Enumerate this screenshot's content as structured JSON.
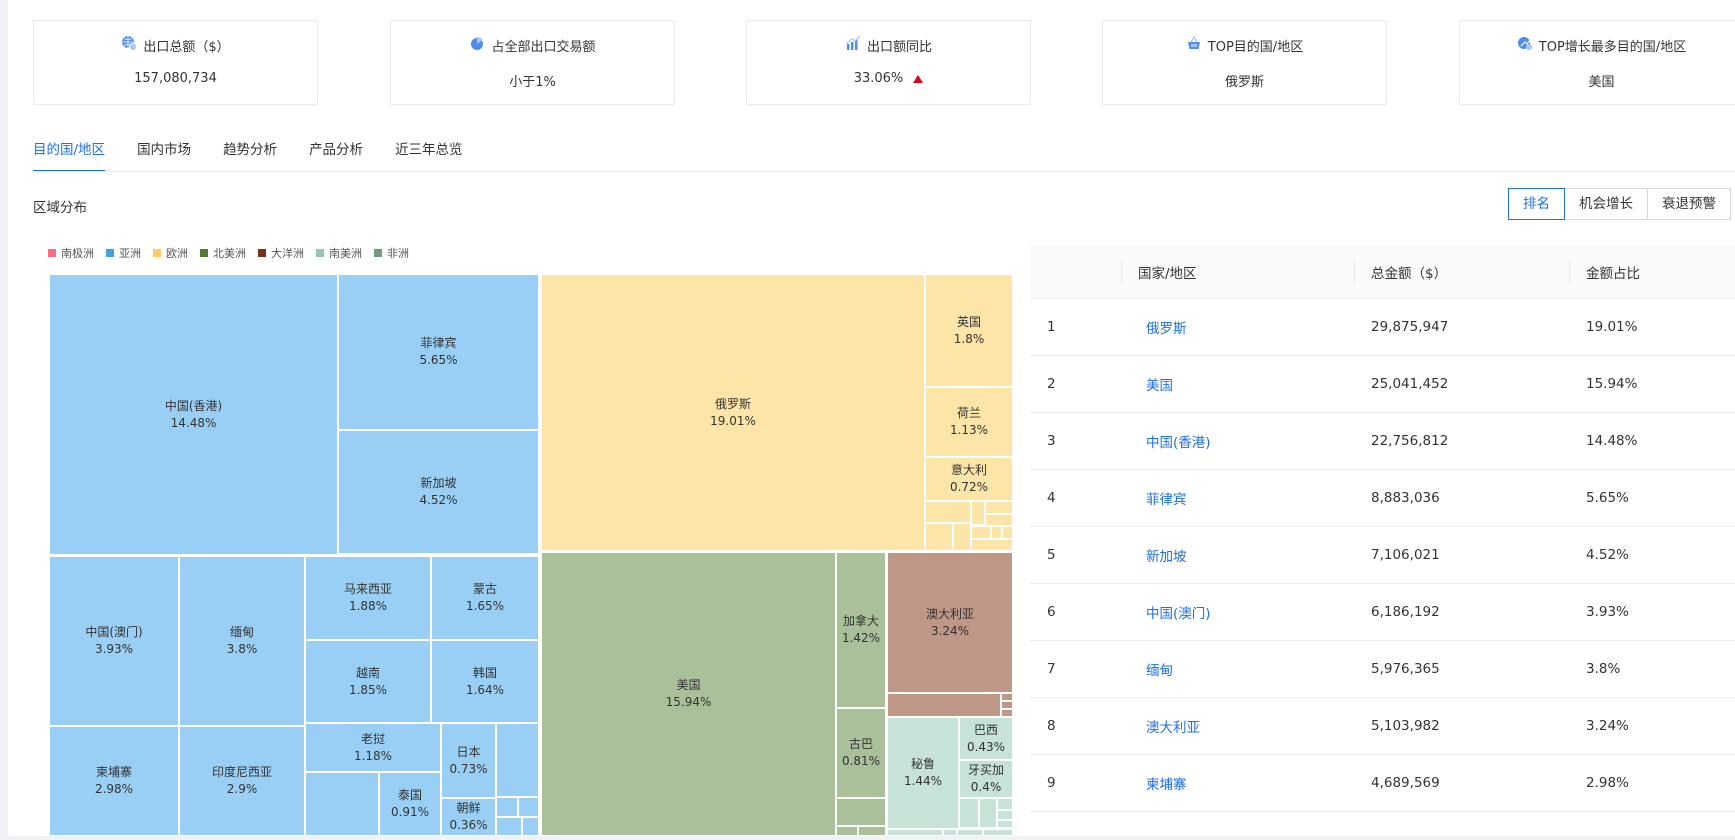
{
  "cards": [
    {
      "title": "出口总额（$）",
      "value": "157,080,734",
      "icon": "globe-dollar-icon"
    },
    {
      "title": "占全部出口交易额",
      "value": "小于1%",
      "icon": "pie-icon"
    },
    {
      "title": "出口额同比",
      "value": "33.06%",
      "icon": "bar-chart-icon",
      "trend": "up"
    },
    {
      "title": "TOP目的国/地区",
      "value": "俄罗斯",
      "icon": "basket-icon"
    },
    {
      "title": "TOP增长最多目的国/地区",
      "value": "美国",
      "icon": "globe-growth-icon"
    }
  ],
  "tabs": [
    "目的国/地区",
    "国内市场",
    "趋势分析",
    "产品分析",
    "近三年总览"
  ],
  "active_tab": "目的国/地区",
  "section_title": "区域分布",
  "view_buttons": [
    "排名",
    "机会增长",
    "衰退预警"
  ],
  "active_view": "排名",
  "colors": {
    "accent": "#1f6fe8",
    "up": "#d9001b"
  },
  "chart_data": {
    "type": "treemap",
    "legend": [
      {
        "name": "南极洲",
        "color": "#ff6b81"
      },
      {
        "name": "亚洲",
        "color": "#3ea0e8"
      },
      {
        "name": "欧洲",
        "color": "#ffc95c"
      },
      {
        "name": "北美洲",
        "color": "#4e7f2f"
      },
      {
        "name": "大洋洲",
        "color": "#7a3118"
      },
      {
        "name": "南美洲",
        "color": "#92c8b0"
      },
      {
        "name": "非洲",
        "color": "#6f9c7c"
      }
    ],
    "legend_position": "top-left",
    "nodes": [
      {
        "name": "中国(香港)",
        "value": "14.48%",
        "region": "亚洲"
      },
      {
        "name": "菲律宾",
        "value": "5.65%",
        "region": "亚洲"
      },
      {
        "name": "新加坡",
        "value": "4.52%",
        "region": "亚洲"
      },
      {
        "name": "中国(澳门)",
        "value": "3.93%",
        "region": "亚洲"
      },
      {
        "name": "缅甸",
        "value": "3.8%",
        "region": "亚洲"
      },
      {
        "name": "柬埔寨",
        "value": "2.98%",
        "region": "亚洲"
      },
      {
        "name": "印度尼西亚",
        "value": "2.9%",
        "region": "亚洲"
      },
      {
        "name": "马来西亚",
        "value": "1.88%",
        "region": "亚洲"
      },
      {
        "name": "蒙古",
        "value": "1.65%",
        "region": "亚洲"
      },
      {
        "name": "越南",
        "value": "1.85%",
        "region": "亚洲"
      },
      {
        "name": "韩国",
        "value": "1.64%",
        "region": "亚洲"
      },
      {
        "name": "老挝",
        "value": "1.18%",
        "region": "亚洲"
      },
      {
        "name": "日本",
        "value": "0.73%",
        "region": "亚洲"
      },
      {
        "name": "泰国",
        "value": "0.91%",
        "region": "亚洲"
      },
      {
        "name": "朝鲜",
        "value": "0.36%",
        "region": "亚洲"
      },
      {
        "name": "俄罗斯",
        "value": "19.01%",
        "region": "欧洲"
      },
      {
        "name": "英国",
        "value": "1.8%",
        "region": "欧洲"
      },
      {
        "name": "荷兰",
        "value": "1.13%",
        "region": "欧洲"
      },
      {
        "name": "意大利",
        "value": "0.72%",
        "region": "欧洲"
      },
      {
        "name": "美国",
        "value": "15.94%",
        "region": "北美洲"
      },
      {
        "name": "加拿大",
        "value": "1.42%",
        "region": "北美洲"
      },
      {
        "name": "古巴",
        "value": "0.81%",
        "region": "北美洲"
      },
      {
        "name": "澳大利亚",
        "value": "3.24%",
        "region": "大洋洲"
      },
      {
        "name": "秘鲁",
        "value": "1.44%",
        "region": "南美洲"
      },
      {
        "name": "巴西",
        "value": "0.43%",
        "region": "南美洲"
      },
      {
        "name": "牙买加",
        "value": "0.4%",
        "region": "南美洲"
      }
    ]
  },
  "table": {
    "headers": [
      "",
      "国家/地区",
      "总金额（$）",
      "金额占比"
    ],
    "rows": [
      [
        "1",
        "俄罗斯",
        "29,875,947",
        "19.01%"
      ],
      [
        "2",
        "美国",
        "25,041,452",
        "15.94%"
      ],
      [
        "3",
        "中国(香港)",
        "22,756,812",
        "14.48%"
      ],
      [
        "4",
        "菲律宾",
        "8,883,036",
        "5.65%"
      ],
      [
        "5",
        "新加坡",
        "7,106,021",
        "4.52%"
      ],
      [
        "6",
        "中国(澳门)",
        "6,186,192",
        "3.93%"
      ],
      [
        "7",
        "缅甸",
        "5,976,365",
        "3.8%"
      ],
      [
        "8",
        "澳大利亚",
        "5,103,982",
        "3.24%"
      ],
      [
        "9",
        "柬埔寨",
        "4,689,569",
        "2.98%"
      ]
    ]
  }
}
